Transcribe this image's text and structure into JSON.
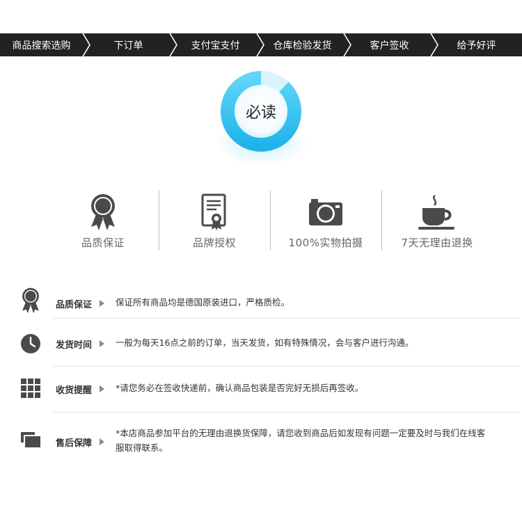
{
  "steps": [
    "商品搜索选购",
    "下订单",
    "支付宝支付",
    "仓库检验发货",
    "客户签收",
    "给予好评"
  ],
  "ring": {
    "label": "必读",
    "accent": "#3cc6f2",
    "progress": 0.88
  },
  "features": [
    {
      "icon": "award-ribbon-icon",
      "label": "品质保证"
    },
    {
      "icon": "certificate-icon",
      "label": "品牌授权"
    },
    {
      "icon": "camera-icon",
      "label": "100%实物拍摄"
    },
    {
      "icon": "coffee-cup-icon",
      "label": "7天无理由退换"
    }
  ],
  "info": [
    {
      "icon": "award-ribbon-icon",
      "title": "品质保证",
      "text": "保证所有商品均是德国原装进口，严格质检。"
    },
    {
      "icon": "clock-icon",
      "title": "发货时间",
      "text": "一般为每天16点之前的订单，当天发货，如有特殊情况，会与客户进行沟通。"
    },
    {
      "icon": "grid-icon",
      "title": "收货提醒",
      "text": "*请您务必在签收快递前，确认商品包装是否完好无损后再签收。"
    },
    {
      "icon": "windows-stack-icon",
      "title": "售后保障",
      "text": "*本店商品参加平台的无理由退换货保障，请您收到商品后如发现有问题一定要及时与我们在线客服取得联系。"
    }
  ]
}
